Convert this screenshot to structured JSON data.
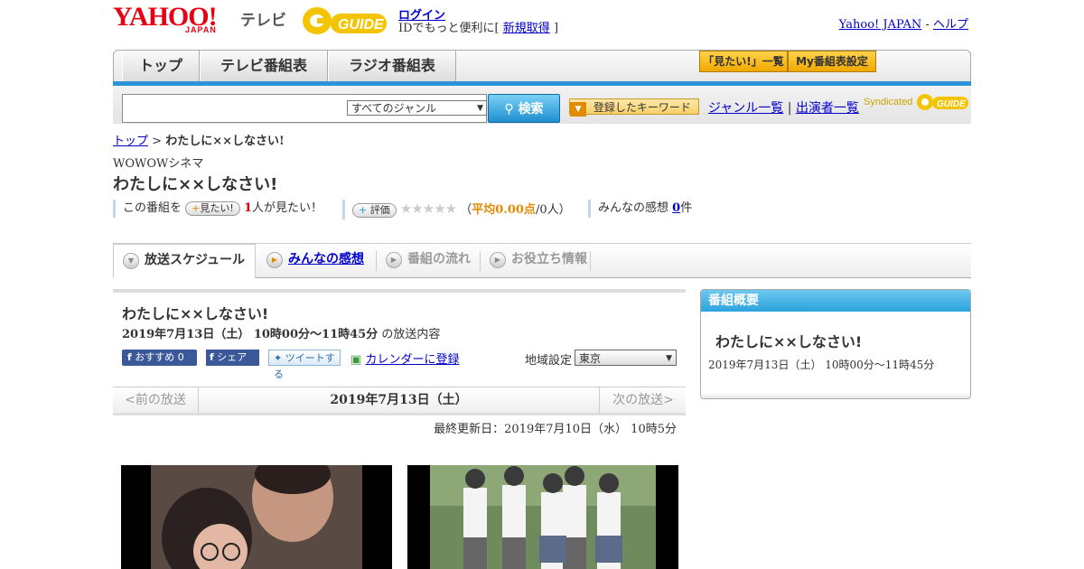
{
  "header": {
    "logo_yahoo": "YAHOO!",
    "logo_japan": "JAPAN",
    "logo_tv": "テレビ",
    "gguide": "GUIDE",
    "login": "ログイン",
    "login_sub_prefix": "IDでもっと便利に[",
    "signup": "新規取得",
    "login_sub_suffix": "]",
    "yahoo_japan": "Yahoo! JAPAN",
    "sep": "-",
    "help": "ヘルプ"
  },
  "nav": {
    "tabs": [
      "トップ",
      "テレビ番組表",
      "ラジオ番組表"
    ],
    "mitai_list": "「見たい!」一覧",
    "my_bangumi": "My番組表設定"
  },
  "search": {
    "genre_selected": "すべてのジャンル",
    "button": "検索",
    "keyword_button": "登録したキーワード",
    "genre_list": "ジャンル一覧",
    "divider": "|",
    "cast_list": "出演者一覧",
    "syndicated": "Syndicated"
  },
  "breadcrumb": {
    "top": "トップ",
    "sep": ">",
    "current": "わたしに××しなさい!"
  },
  "program": {
    "channel": "WOWOWシネマ",
    "title": "わたしに××しなさい!",
    "this_program": "この番組を",
    "mitai_btn": "見たい!",
    "mitai_count": "1",
    "mitai_text": "人が見たい！",
    "rating_btn": "評価",
    "stars": "★★★★★",
    "avg_prefix": "（",
    "avg_label": "平均0.00点",
    "avg_suffix": "/0人）",
    "impressions_label": "みんなの感想",
    "impressions_count": "0",
    "impressions_unit": "件"
  },
  "tabs": [
    {
      "label": "放送スケジュール"
    },
    {
      "label": "みんなの感想"
    },
    {
      "label": "番組の流れ"
    },
    {
      "label": "お役立ち情報"
    }
  ],
  "broadcast": {
    "title": "わたしに××しなさい!",
    "datetime": "2019年7月13日（土） 10時00分～11時45分",
    "content_suffix": "の放送内容",
    "recommend": "おすすめ",
    "recommend_count": "0",
    "share": "シェア",
    "tweet": "ツイートする",
    "calendar": "カレンダーに登録",
    "region_label": "地域設定",
    "region_value": "東京",
    "prev": "<前の放送",
    "date": "2019年7月13日（土）",
    "next": "次の放送>",
    "updated": "最終更新日：2019年7月10日（水） 10時5分"
  },
  "summary": {
    "head": "番組概要",
    "title": "わたしに××しなさい!",
    "datetime": "2019年7月13日（土） 10時00分～11時45分"
  },
  "colors": {
    "accent_blue": "#2b93d6",
    "yahoo_red": "#e60012",
    "gold": "#f0a800"
  }
}
